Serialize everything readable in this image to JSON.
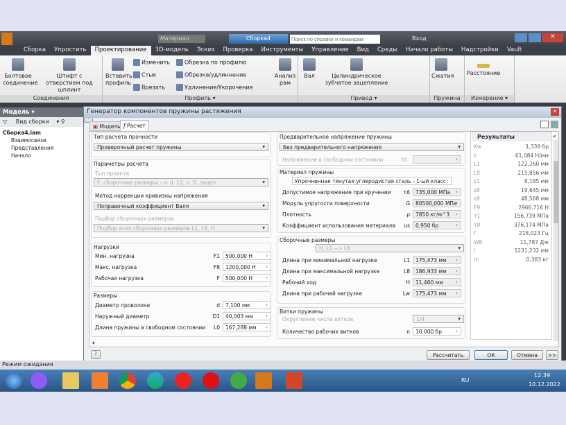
{
  "app": {
    "material_placeholder": "Материал",
    "doc_tab": "Сборка4",
    "search_placeholder": "Поиск по справке и командам",
    "signin": "Вход"
  },
  "tabs": [
    "Сборка",
    "Упростить",
    "Проектирование",
    "3D-модель",
    "Эскиз",
    "Проверка",
    "Инструменты",
    "Управление",
    "Вид",
    "Среды",
    "Начало работы",
    "Надстройки",
    "Vault"
  ],
  "active_tab": "Проектирование",
  "ribbon": {
    "connections": {
      "label": "Соединения",
      "bolt": "Болтовое соединение",
      "pin": "Штифт с отверстием под шплинт"
    },
    "profile": {
      "label": "Профиль ▾",
      "insert": "Вставить профиль",
      "change": "Изменить",
      "joint": "Стык",
      "cut": "Врезать",
      "trim_profile": "Обрезка по профилю",
      "trim_extend": "Обрезка/удлиннение",
      "lengthen": "Удлинение/Укорочение",
      "frame_analysis": "Анализ рам"
    },
    "drive": {
      "label": "Привод ▾",
      "shaft": "Вал",
      "spur": "Цилиндрическое зубчатое зацепление"
    },
    "spring": {
      "label": "Пружина",
      "compression": "Сжатия"
    },
    "measure": {
      "label": "Измерение ▾",
      "distance": "Расстояние"
    }
  },
  "browser": {
    "title": "Модель ▾",
    "view": "Вид сборки",
    "tree": [
      "Сборка4.iam",
      "Взаимосвязи",
      "Представления",
      "Начало"
    ]
  },
  "dialog": {
    "title": "Генератор компонентов пружины растяжения",
    "tabs": [
      "Модель",
      "Расчет"
    ],
    "strength_type": {
      "title": "Тип расчета прочности",
      "value": "Проверочный расчет пружины"
    },
    "calc_params": {
      "title": "Параметры расчета",
      "project_type_label": "Тип проекта",
      "project_type": "F, сборочные размеры --> d, L0, n, D, зацеп",
      "curv_label": "Метод коррекции кривизны напряжения",
      "curv": "Поправочный коэффициент Валя",
      "fit_label": "Подбор сборочных размеров",
      "fit": "Подбор всех сборочных размеров L1, L8, H"
    },
    "loads": {
      "title": "Нагрузки",
      "rows": [
        {
          "label": "Мин. нагрузка",
          "sym": "F1",
          "value": "500,000 Н"
        },
        {
          "label": "Макс. нагрузка",
          "sym": "F8",
          "value": "1200,000 Н"
        },
        {
          "label": "Рабочая нагрузка",
          "sym": "F",
          "value": "500,000 Н"
        }
      ]
    },
    "dims": {
      "title": "Размеры",
      "rows": [
        {
          "label": "Диаметр проволоки",
          "sym": "d",
          "value": "7,100 мм"
        },
        {
          "label": "Наружный диаметр",
          "sym": "D1",
          "value": "40,003 мм"
        },
        {
          "label": "Длина пружины в свободном состоянии",
          "sym": "L0",
          "value": "167,288 мм"
        }
      ]
    },
    "pretension": {
      "title": "Предварительное напряжение пружины",
      "value": "Без предварительного напряжения",
      "free_label": "Напряжение в свободном состоянии",
      "free_sym": "τ0"
    },
    "material": {
      "title": "Материал пружины",
      "name": "Упрочненная тянутая углеродистая сталь - 1-ый класс",
      "checked": true,
      "rows": [
        {
          "label": "Допустимое напряжение при кручении",
          "sym": "τA",
          "value": "735,000 МПа"
        },
        {
          "label": "Модуль упругости поверхности",
          "sym": "G",
          "value": "80500,000 МПа"
        },
        {
          "label": "Плотность",
          "sym": "ρ",
          "value": "7850 кг/м^3"
        },
        {
          "label": "Коэффициент использования материала",
          "sym": "us",
          "value": "0,950 бр"
        }
      ]
    },
    "assembly": {
      "title": "Сборочные размеры",
      "mode": "H, L1 --> L8",
      "rows": [
        {
          "label": "Длина при минимальной нагрузке",
          "sym": "L1",
          "value": "175,473 мм"
        },
        {
          "label": "Длина при максимальной нагрузке",
          "sym": "L8",
          "value": "186,933 мм"
        },
        {
          "label": "Рабочий ход",
          "sym": "H",
          "value": "11,460 мм"
        },
        {
          "label": "Длина при рабочей нагрузке",
          "sym": "Lw",
          "value": "175,473 мм"
        }
      ]
    },
    "coils": {
      "title": "Витки пружины",
      "round_label": "Округление числа витков",
      "round": "1/4",
      "count_label": "Количество рабочих витков",
      "count_sym": "n",
      "count": "10,000 бр"
    },
    "results": {
      "title": "Результаты",
      "rows": [
        [
          "Kw",
          "1,339 бр"
        ],
        [
          "k",
          "61,084 Н/мм"
        ],
        [
          "L1",
          "122,260 мм"
        ],
        [
          "L9",
          "215,856 мм"
        ],
        [
          "s1",
          "8,185 мм"
        ],
        [
          "s8",
          "19,645 мм"
        ],
        [
          "s9",
          "48,568 мм"
        ],
        [
          "F9",
          "2966,716 Н"
        ],
        [
          "τ1",
          "156,739 МПа"
        ],
        [
          "τ8",
          "376,174 МПа"
        ],
        [
          "f",
          "218,023 Гц"
        ],
        [
          "W8",
          "11,787 Дж"
        ],
        [
          "l",
          "1231,232 мм"
        ],
        [
          "m",
          "0,383 кг"
        ]
      ]
    },
    "buttons": {
      "calc": "Рассчитать",
      "ok": "ОК",
      "cancel": "Отмена",
      "more": ">>"
    }
  },
  "status": "Режим ожидания",
  "tray": {
    "lang": "RU",
    "time": "12:39",
    "date": "10.12.2022"
  }
}
